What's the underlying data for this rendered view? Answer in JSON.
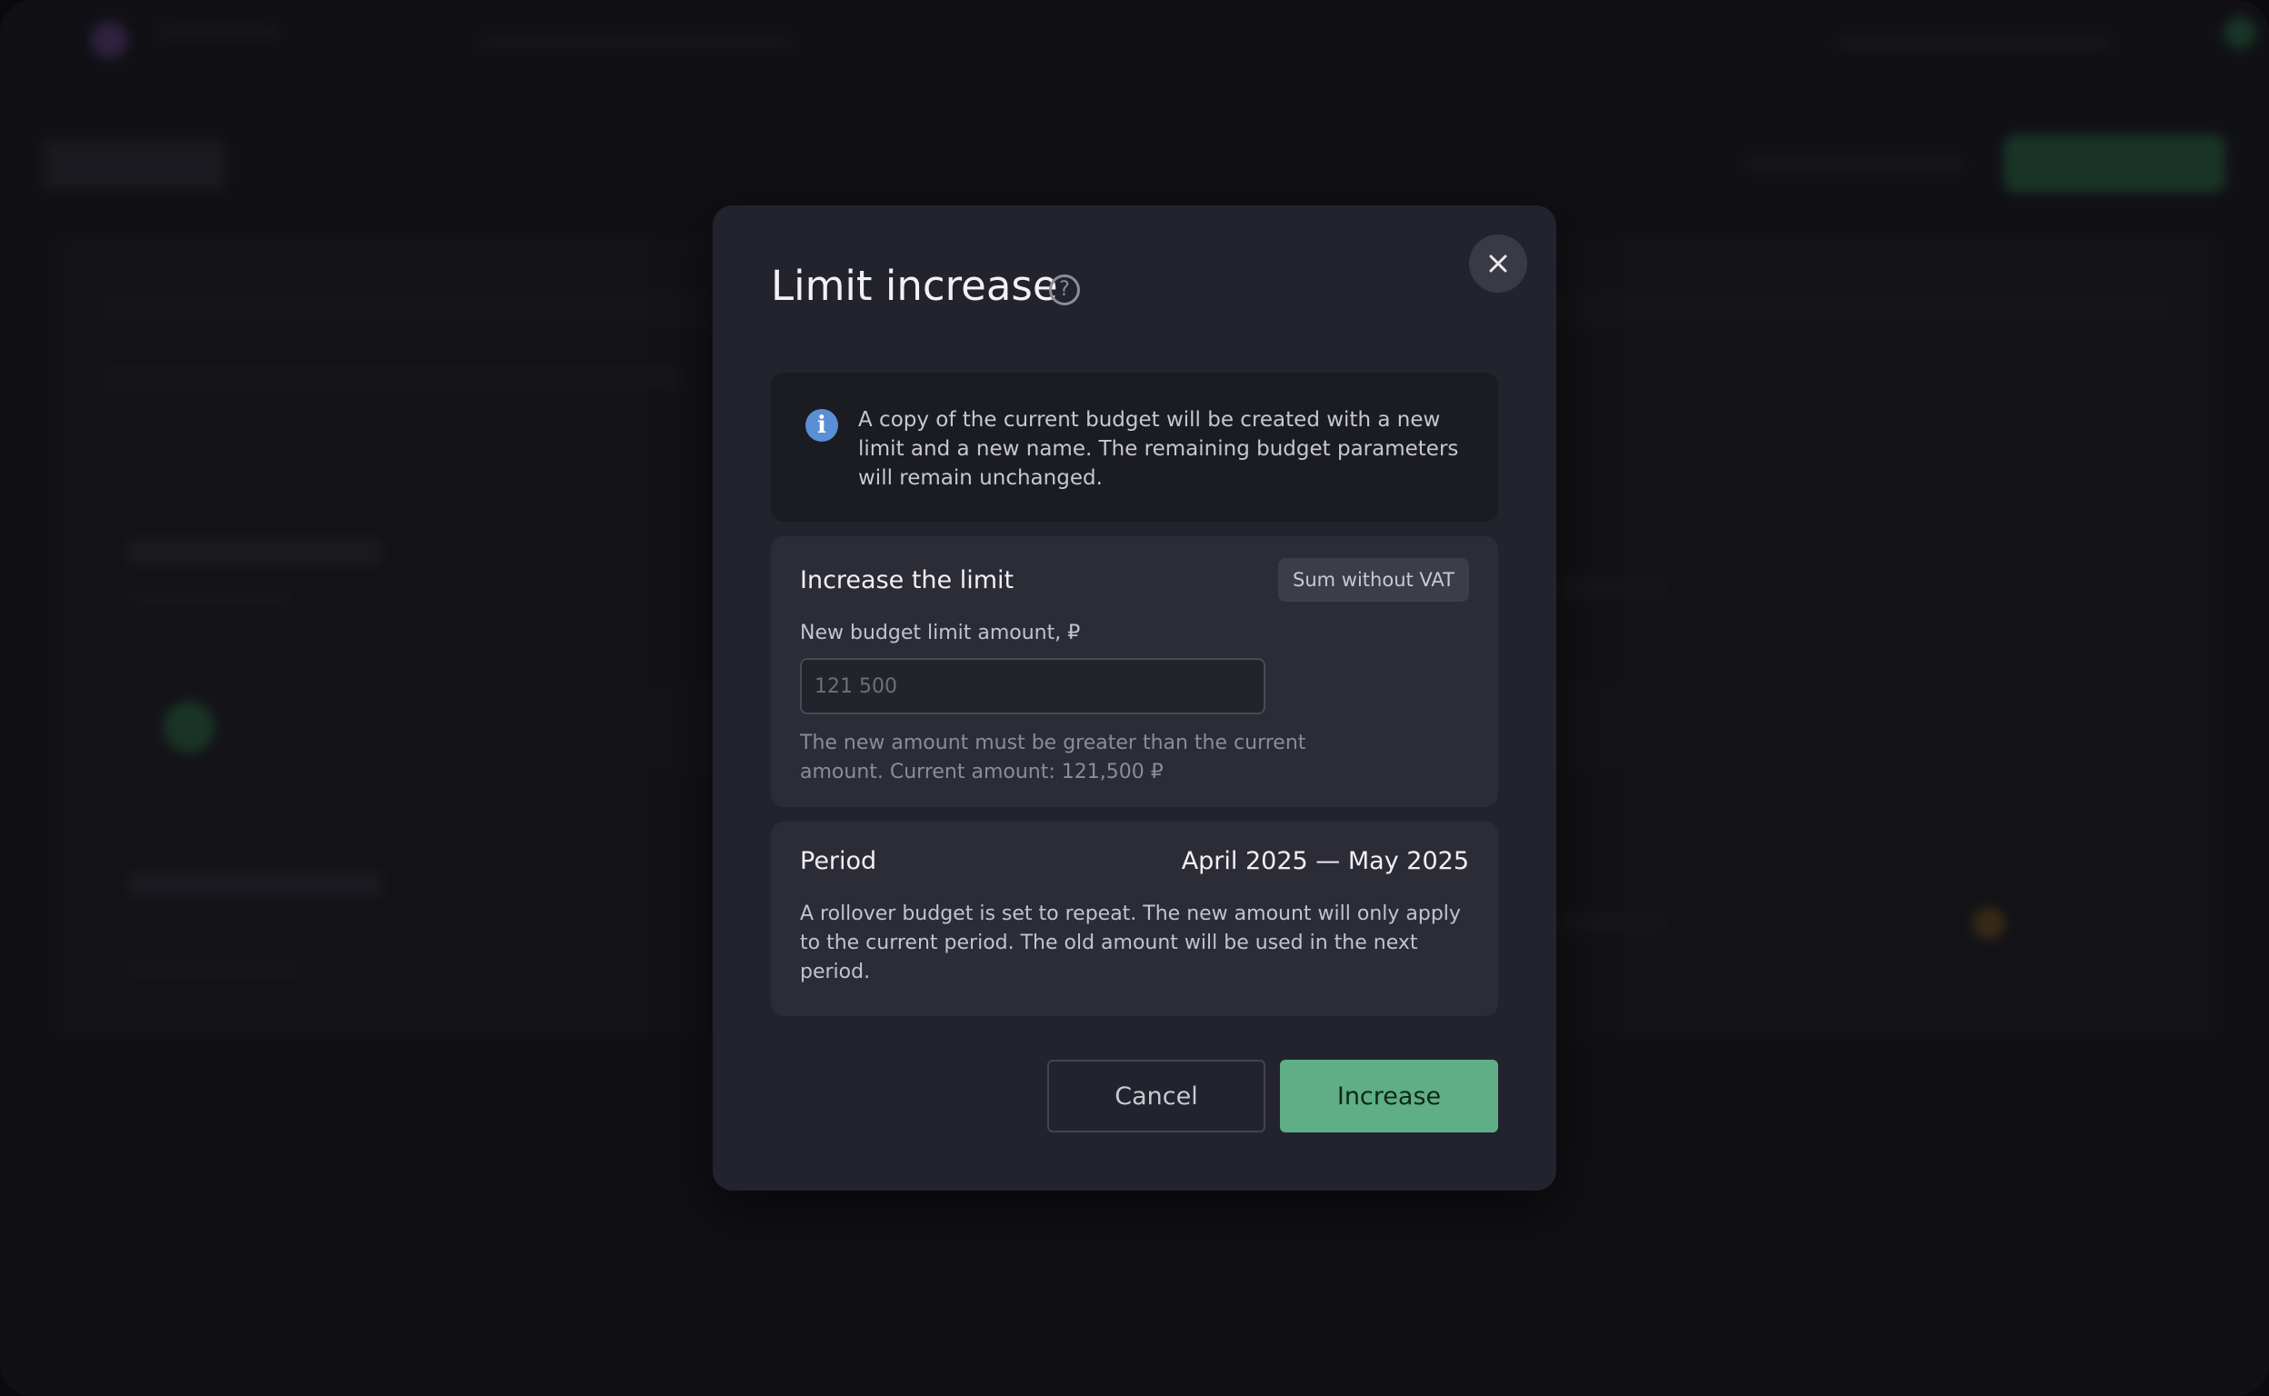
{
  "modal": {
    "title": "Limit increase",
    "help_icon": "question-circle-icon",
    "close_icon": "close-icon",
    "info": {
      "icon": "info-icon",
      "text": "A copy of the current budget will be created with a new limit and a new name. The remaining budget parameters will remain unchanged."
    },
    "limit": {
      "heading": "Increase the limit",
      "vat_badge": "Sum without VAT",
      "field_label": "New budget limit amount, ₽",
      "placeholder": "121 500",
      "value": "",
      "hint": "The new amount must be greater than the current amount. Current amount: 121,500 ₽"
    },
    "period": {
      "heading": "Period",
      "range": "April 2025 — May 2025",
      "text": "A rollover budget is set to repeat. The new amount will only apply to the current period. The old amount will be used in the next period."
    },
    "actions": {
      "cancel": "Cancel",
      "increase": "Increase"
    }
  },
  "colors": {
    "accent": "#5fae86",
    "info": "#5a8fd6",
    "modal_bg": "#23232d"
  }
}
